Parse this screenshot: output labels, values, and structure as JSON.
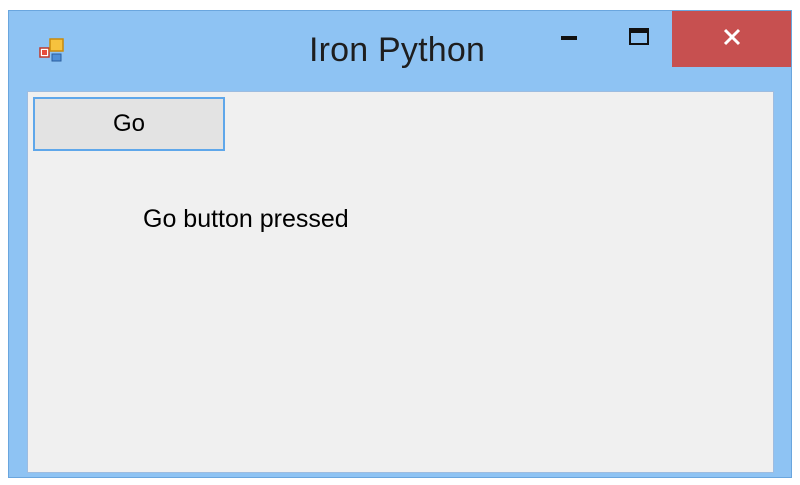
{
  "window": {
    "title": "Iron Python",
    "app_icon": "windows-form-icon",
    "controls": {
      "minimize_icon": "minimize-icon",
      "maximize_icon": "maximize-icon",
      "close_icon": "close-icon"
    }
  },
  "form": {
    "go_button_label": "Go",
    "status_label": "Go button pressed"
  },
  "colors": {
    "titlebar": "#8ec3f3",
    "close_button": "#c75050",
    "client_background": "#f0f0f0",
    "button_focus_border": "#5fa7ea"
  }
}
